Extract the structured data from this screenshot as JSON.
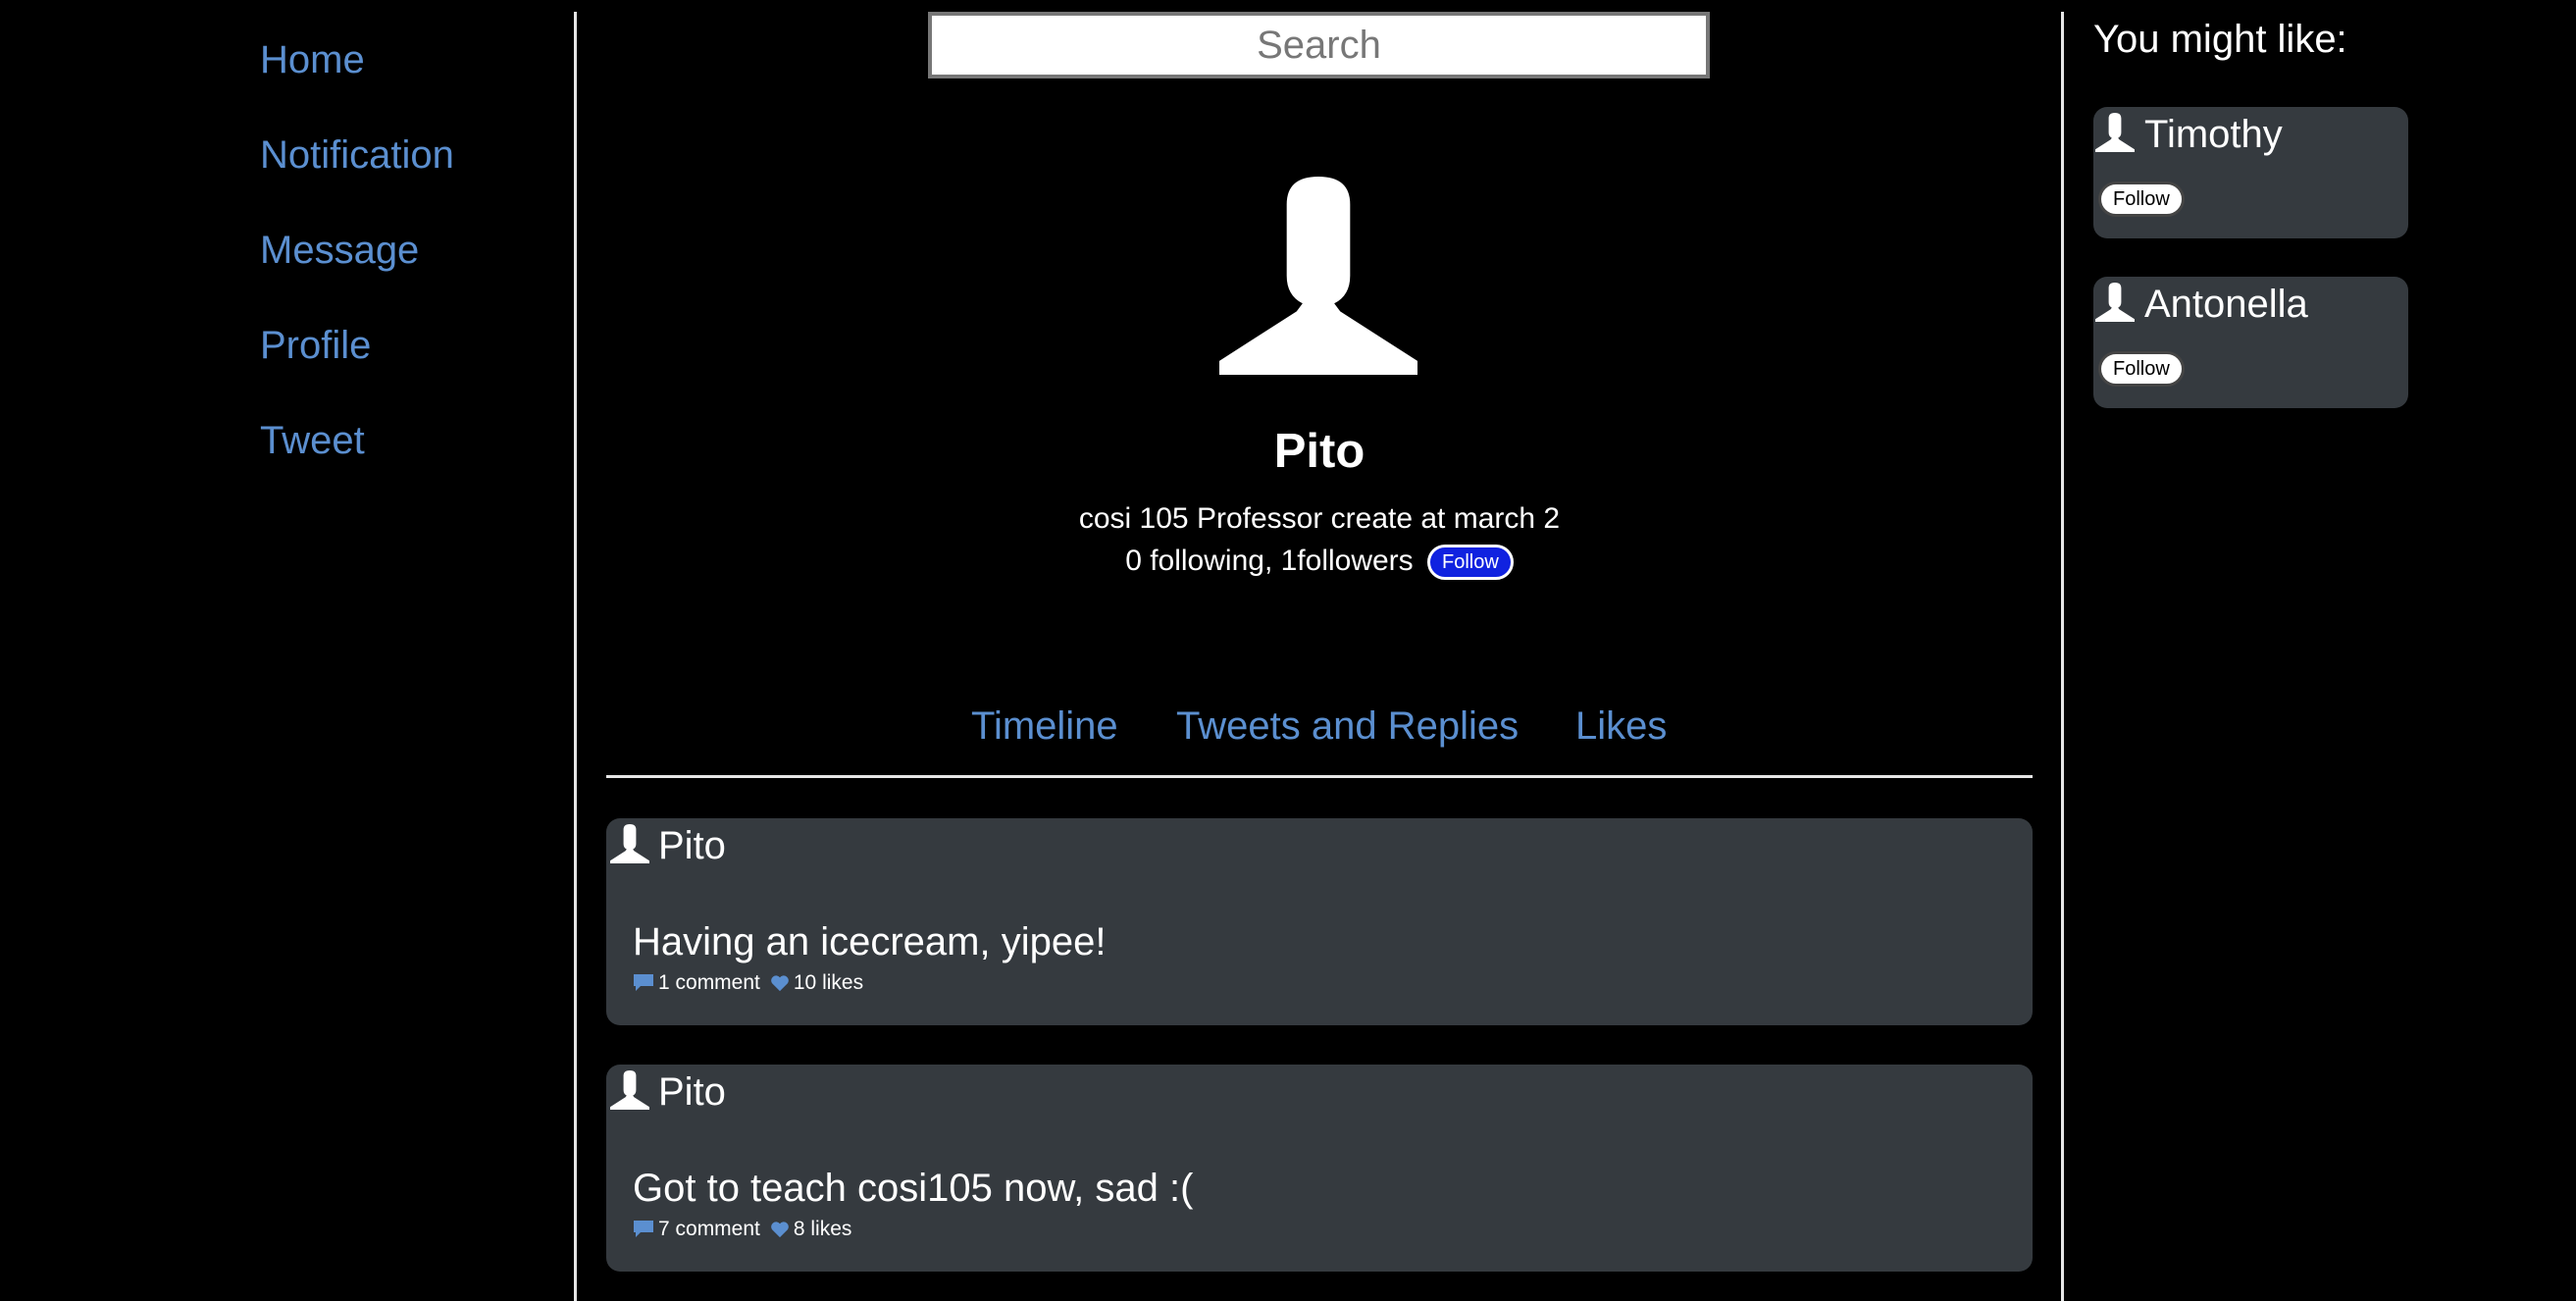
{
  "nav": {
    "items": [
      {
        "label": "Home"
      },
      {
        "label": "Notification"
      },
      {
        "label": "Message"
      },
      {
        "label": "Profile"
      },
      {
        "label": "Tweet"
      }
    ]
  },
  "search": {
    "placeholder": "Search"
  },
  "profile": {
    "name": "Pito",
    "bio": "cosi 105 Professor create at march 2",
    "stats": "0 following, 1followers",
    "follow_label": "Follow"
  },
  "tabs": [
    {
      "label": "Timeline"
    },
    {
      "label": "Tweets and Replies"
    },
    {
      "label": "Likes"
    }
  ],
  "tweets": [
    {
      "author": "Pito",
      "text": "Having an icecream, yipee!",
      "comments": "1 comment",
      "likes": "10 likes"
    },
    {
      "author": "Pito",
      "text": "Got to teach cosi105 now, sad :(",
      "comments": "7 comment",
      "likes": "8 likes"
    }
  ],
  "sidebar": {
    "title": "You might like:",
    "suggestions": [
      {
        "name": "Timothy",
        "follow_label": "Follow"
      },
      {
        "name": "Antonella",
        "follow_label": "Follow"
      }
    ]
  },
  "colors": {
    "background": "#000000",
    "link": "#5b8fd0",
    "card": "#353a3f",
    "follow_primary": "#1022e0"
  },
  "icons": [
    "user-icon",
    "comment-icon",
    "heart-icon"
  ]
}
